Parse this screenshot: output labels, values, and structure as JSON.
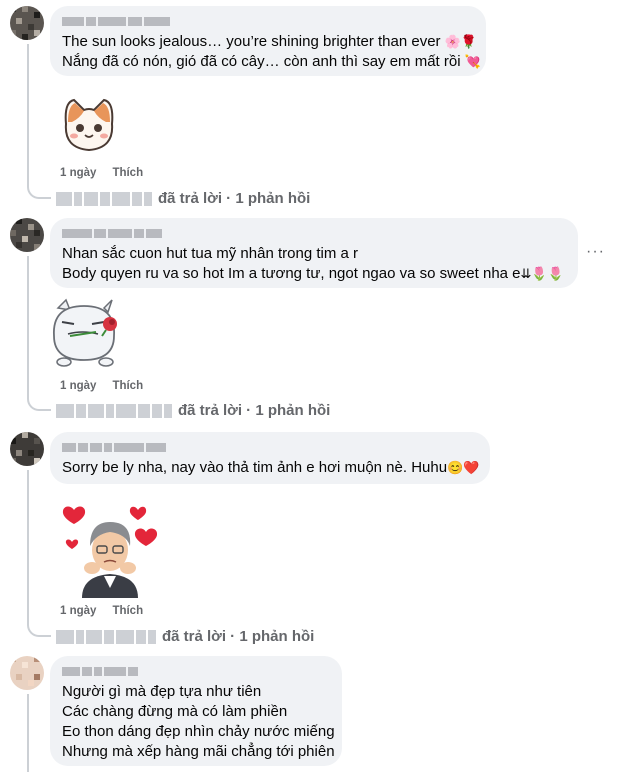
{
  "comments": [
    {
      "lines": [
        "The sun looks jealous… you’re shining brighter than ever",
        "Nắng đã có nón, gió đã có cây… còn anh thì say em mất rồi"
      ],
      "line_emojis": [
        "🌸🌹",
        "💘"
      ],
      "meta_time": "1 ngày",
      "meta_like": "Thích",
      "reply_text": "đã trả lời · 1 phản hồi",
      "sticker": "cat-sticker"
    },
    {
      "lines": [
        "Nhan sắc cuon hut tua mỹ nhân trong tim a r",
        "Body quyen ru va so hot Im a tương tư, ngot ngao va so sweet nha e"
      ],
      "line_emojis": [
        "",
        "⇊🌷🌷"
      ],
      "meta_time": "1 ngày",
      "meta_like": "Thích",
      "reply_text": "đã trả lời · 1 phản hồi",
      "more": "···",
      "sticker": "rose-blob-sticker"
    },
    {
      "lines": [
        "Sorry be ly nha, nay vào thả tim ảnh e hơi muộn nè. Huhu"
      ],
      "line_emojis": [
        "😊❤️"
      ],
      "meta_time": "1 ngày",
      "meta_like": "Thích",
      "reply_text": "đã trả lời · 1 phản hồi",
      "sticker": "hearts-man-sticker"
    },
    {
      "lines": [
        "Người gì mà đẹp tựa như tiên",
        "Các chàng đừng mà có làm phiền",
        "Eo thon dáng đẹp nhìn chảy nước miếng",
        "Nhưng mà xếp hàng mãi chẳng tới phiên"
      ]
    }
  ]
}
